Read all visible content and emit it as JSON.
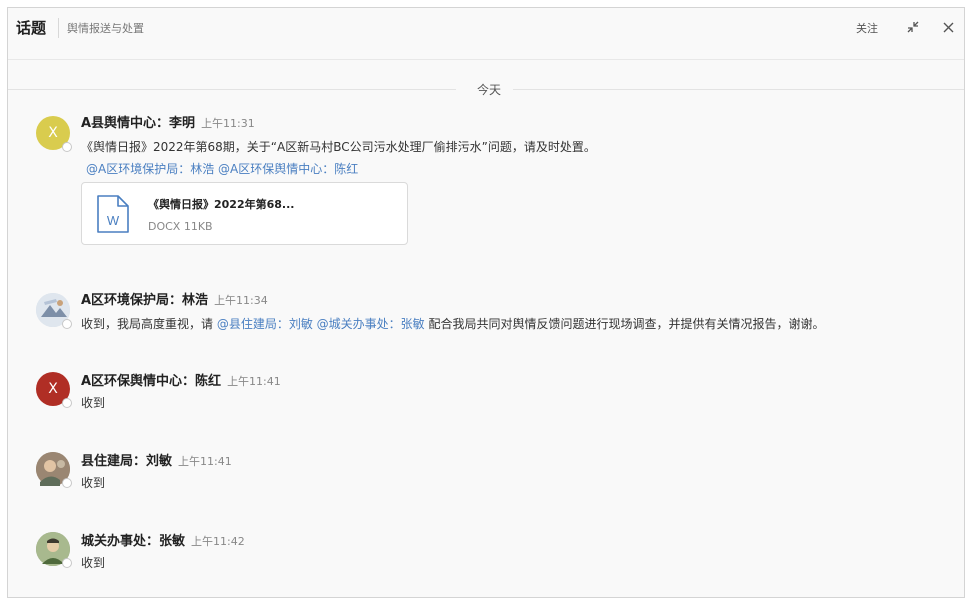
{
  "header": {
    "title": "话题",
    "subtitle": "舆情报送与处置",
    "follow_label": "关注",
    "minimize_icon": "collapse-icon",
    "close_icon": "close-icon"
  },
  "date_divider": "今天",
  "colors": {
    "mention": "#4a7fc1",
    "avatar_yellow": "#d9cc4e",
    "avatar_red": "#b02e25"
  },
  "messages": [
    {
      "sender": "A县舆情中心：李明",
      "time": "上午11:31",
      "avatar_letter": "X",
      "text": "《舆情日报》2022年第68期，关于“A区新马村BC公司污水处理厂偷排污水”问题，请及时处置。",
      "mentions": "@A区环境保护局：林浩 @A区环保舆情中心：陈红",
      "attachment": {
        "name": "《舆情日报》2022年第68...",
        "meta": "DOCX 11KB",
        "icon": "word-doc-icon",
        "icon_letter": "W"
      }
    },
    {
      "sender": "A区环境保护局：林浩",
      "time": "上午11:34",
      "text_prefix": "收到，我局高度重视，请 ",
      "mention_1": "@县住建局：刘敏",
      "mention_2": "@城关办事处：张敏",
      "text_suffix": " 配合我局共同对舆情反馈问题进行现场调查，并提供有关情况报告，谢谢。"
    },
    {
      "sender": "A区环保舆情中心：陈红",
      "time": "上午11:41",
      "avatar_letter": "X",
      "text": "收到"
    },
    {
      "sender": "县住建局：刘敏",
      "time": "上午11:41",
      "text": "收到"
    },
    {
      "sender": "城关办事处：张敏",
      "time": "上午11:42",
      "text": "收到"
    }
  ]
}
